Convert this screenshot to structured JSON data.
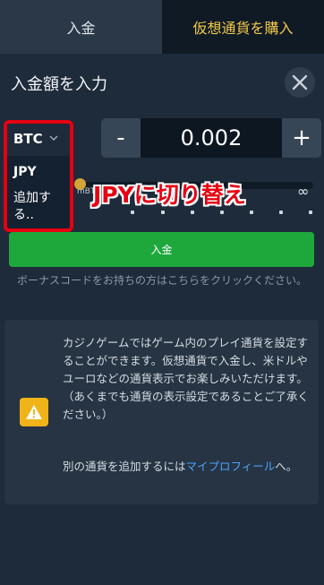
{
  "tabs": [
    {
      "label": "入金"
    },
    {
      "label": "仮想通貨を購入"
    }
  ],
  "title": "入金額を入力",
  "currency": {
    "selected": "BTC",
    "options": [
      "JPY",
      "追加する.."
    ]
  },
  "amount": {
    "minus": "-",
    "value": "0.002",
    "plus": "+"
  },
  "slider": {
    "min_label": "mBT",
    "max_label": "∞",
    "level": 0
  },
  "annotation": "JPYに切り替え",
  "deposit_button": "入金",
  "bonus_link": "ボーナスコードをお持ちの方はこちらをクリックください。",
  "info": {
    "text": "カジノゲームではゲーム内のプレイ通貨を設定することができます。仮想通貨で入金し、米ドルやユーロなどの通貨表示でお楽しみいただけます。（あくまでも通貨の表示設定であることご了承ください。）",
    "add_text_prefix": "別の通貨を追加するには",
    "add_link": "マイプロフィール",
    "add_text_suffix": "へ。"
  },
  "colors": {
    "accent_buy_tab": "#f2c94c",
    "deposit_button": "#1ea83c",
    "annotation_red": "#e60012",
    "warning": "#f0b418"
  }
}
